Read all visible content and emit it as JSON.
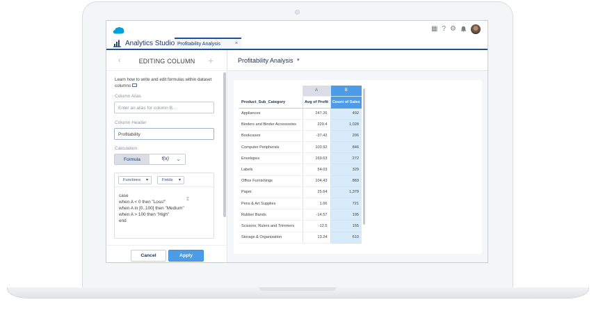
{
  "header": {
    "app_name": "Analytics Studio",
    "tab_label": "Profitability Analysis",
    "tab_close": "×",
    "icons": [
      "apps-grid-icon",
      "help-icon",
      "gear-icon",
      "bell-icon",
      "avatar"
    ],
    "help_glyph": "?",
    "gear_glyph": "⚙",
    "grid_glyph": "▦",
    "bell_glyph": "🔔",
    "brand_color": "#1b5297"
  },
  "panel": {
    "back_glyph": "‹",
    "title": "EDITING COLUMN",
    "add_glyph": "+",
    "hint": "Learn how to write and edit formulas within dataset columns",
    "alias": {
      "label": "Column Alias",
      "placeholder": "Enter an alias for column B..."
    },
    "header_field": {
      "label": "Column Header",
      "value": "Profitability"
    },
    "calculation": {
      "label": "Calculation",
      "mode_formula": "Formula",
      "mode_fx": "f(x)",
      "chevron": "⌄"
    },
    "editor": {
      "functions_label": "Functions",
      "fields_label": "Fields",
      "caret": "▾",
      "cursor_glyph": "Ɪ",
      "lines": [
        "case",
        "when A < 0 then \"Loss!\"",
        "when A in [0..100] then \"Medium\"",
        "when A > 100 then \"High\"",
        "end"
      ]
    },
    "cancel_label": "Cancel",
    "apply_label": "Apply",
    "apply_color": "#4c9ce8"
  },
  "main": {
    "title": "Profitability Analysis",
    "title_caret": "▾",
    "table": {
      "column_letters": [
        "A",
        "B"
      ],
      "headers": [
        "Product_Sub_Category",
        "Avg of Profit",
        "Count of Sales"
      ],
      "rows": [
        [
          "Appliances",
          "247.26",
          "492"
        ],
        [
          "Binders and Binder Accessories",
          "220.4",
          "1,028"
        ],
        [
          "Bookcases",
          "-37.42",
          "206"
        ],
        [
          "Computer Peripherals",
          "103.92",
          "846"
        ],
        [
          "Envelopes",
          "169.63",
          "272"
        ],
        [
          "Labels",
          "54.03",
          "329"
        ],
        [
          "Office Furnishings",
          "104.43",
          "883"
        ],
        [
          "Paper",
          "25.64",
          "1,379"
        ],
        [
          "Pens & Art Supplies",
          "1.66",
          "721"
        ],
        [
          "Rubber Bands",
          "-14.57",
          "195"
        ],
        [
          "Scissors, Rulers and Trimmers",
          "-12.5",
          "155"
        ],
        [
          "Storage & Organization",
          "13.24",
          "610"
        ]
      ]
    }
  }
}
